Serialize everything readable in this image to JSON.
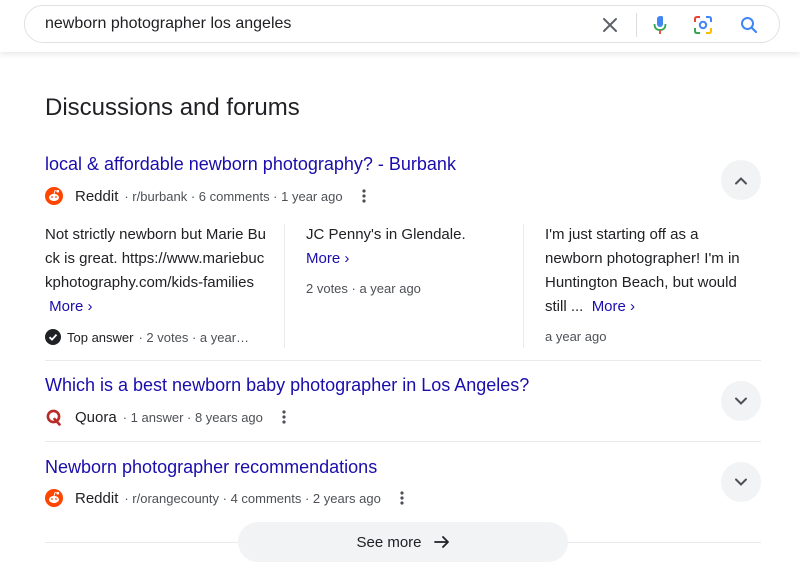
{
  "search": {
    "query": "newborn photographer los angeles",
    "clear_icon": "close-icon",
    "voice_icon": "microphone-icon",
    "lens_icon": "camera-lens-icon",
    "search_icon": "search-icon"
  },
  "section": {
    "title": "Discussions and forums"
  },
  "threads": [
    {
      "title": "local & affordable newborn photography? - Burbank",
      "site": "Reddit",
      "meta": "· r/burbank · 6 comments · 1 year ago",
      "expanded": true,
      "comments": [
        {
          "text": "Not strictly newborn but Marie Buck is great. https://www.mariebuckphotography.com/kids-families",
          "more": "More",
          "footer_badge": "Top answer",
          "footer": "· 2 votes · a year…"
        },
        {
          "text": "JC Penny's in Glendale.",
          "more": "More",
          "footer": "2 votes · a year ago"
        },
        {
          "text": "I'm just starting off as a newborn photographer! I'm in Huntington Beach, but would still ...",
          "more": "More",
          "footer": "a year ago"
        }
      ]
    },
    {
      "title": "Which is a best newborn baby photographer in Los Angeles?",
      "site": "Quora",
      "meta": "· 1 answer · 8 years ago",
      "expanded": false
    },
    {
      "title": "Newborn photographer recommendations",
      "site": "Reddit",
      "meta": "· r/orangecounty · 4 comments · 2 years ago",
      "expanded": false
    }
  ],
  "see_more": {
    "label": "See more"
  },
  "colors": {
    "link": "#1a0dab",
    "reddit": "#ff4500",
    "quora": "#b92b27",
    "mic_blue": "#4285f4",
    "mic_red": "#ea4335"
  }
}
